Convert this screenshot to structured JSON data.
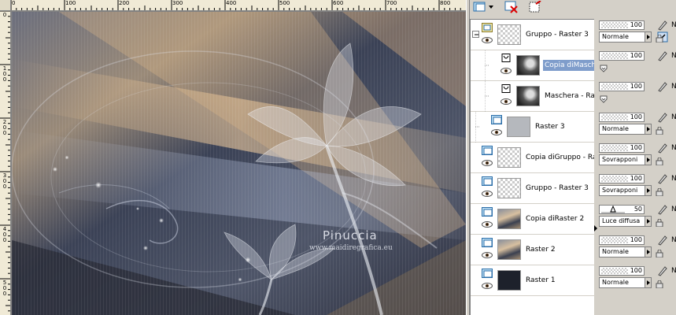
{
  "rulers": {
    "top": [
      "0",
      "100",
      "200",
      "300",
      "400",
      "500",
      "600",
      "700",
      "800"
    ],
    "left": [
      "0",
      "100",
      "200",
      "300",
      "400",
      "500"
    ]
  },
  "watermark": {
    "title": "Pinuccia",
    "url": "www.maidiregrafica.eu"
  },
  "layers": [
    {
      "name": "Gruppo - Raster 3",
      "indent": 0,
      "type": "group",
      "opacity": "100",
      "blend": "Normale",
      "selected": false
    },
    {
      "name": "Copia diMaschera",
      "indent": 2,
      "type": "mask",
      "opacity": "100",
      "blend": "",
      "selected": true
    },
    {
      "name": "Maschera - Rast",
      "indent": 2,
      "type": "mask",
      "opacity": "100",
      "blend": "",
      "selected": false
    },
    {
      "name": "Raster 3",
      "indent": 1,
      "type": "raster",
      "opacity": "100",
      "blend": "Normale",
      "selected": false
    },
    {
      "name": "Copia diGruppo - Ra",
      "indent": 0,
      "type": "raster",
      "opacity": "100",
      "blend": "Sovrapponi",
      "selected": false
    },
    {
      "name": "Gruppo - Raster 3",
      "indent": 0,
      "type": "raster",
      "opacity": "100",
      "blend": "Sovrapponi",
      "selected": false
    },
    {
      "name": "Copia diRaster 2",
      "indent": 0,
      "type": "raster",
      "opacity": "50",
      "blend": "Luce diffusa",
      "selected": false
    },
    {
      "name": "Raster 2",
      "indent": 0,
      "type": "raster",
      "opacity": "100",
      "blend": "Normale",
      "selected": false
    },
    {
      "name": "Raster 1",
      "indent": 0,
      "type": "raster",
      "opacity": "100",
      "blend": "Normale",
      "selected": false
    }
  ],
  "colors": {
    "selection": "#7f9dcb",
    "panel": "#d4d0c8"
  },
  "toolbar_icons": [
    "new-layer-icon",
    "delete-layer-icon",
    "mask-icon"
  ]
}
